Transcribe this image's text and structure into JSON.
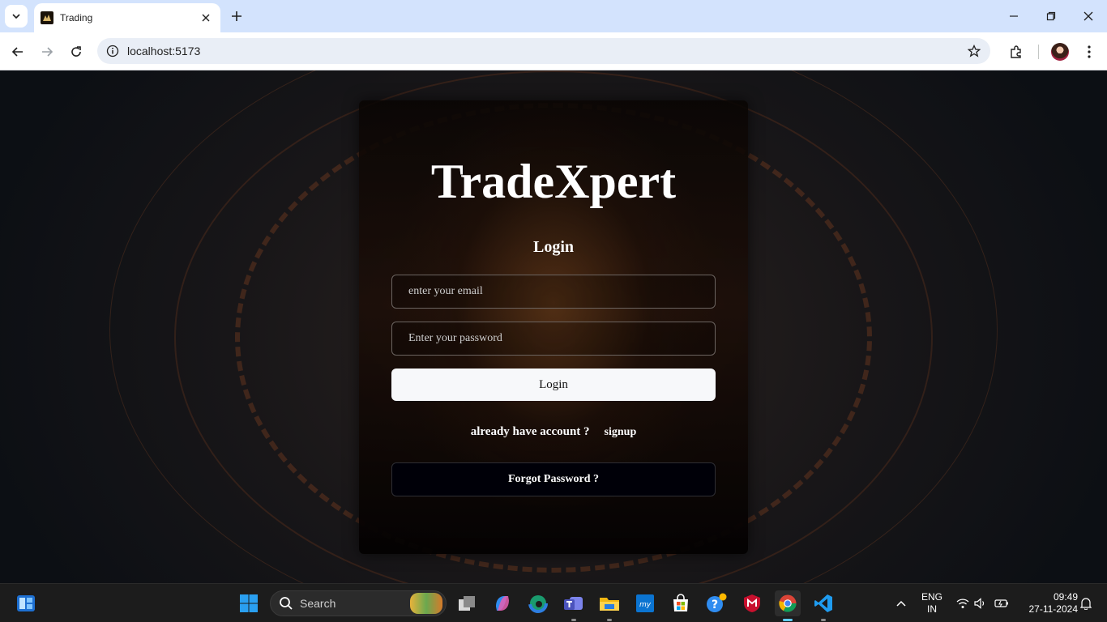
{
  "browser": {
    "tab_title": "Trading",
    "url": "localhost:5173"
  },
  "page": {
    "brand": "TradeXpert",
    "heading": "Login",
    "email_placeholder": "enter your email",
    "password_placeholder": "Enter your password",
    "login_button": "Login",
    "already_text": "already have account ?",
    "signup_link": "signup",
    "forgot_button": "Forgot Password ?"
  },
  "taskbar": {
    "search_label": "Search",
    "language_line1": "ENG",
    "language_line2": "IN",
    "time": "09:49",
    "date": "27-11-2024",
    "apps": [
      "start-icon",
      "search-icon",
      "task-view-icon",
      "copilot-icon",
      "edge-icon",
      "teams-icon",
      "file-explorer-icon",
      "myhp-icon",
      "microsoft-store-icon",
      "help-icon",
      "mcafee-icon",
      "chrome-icon",
      "vscode-icon"
    ]
  },
  "colors": {
    "tabstrip": "#d3e3fd",
    "card_bg": "#140a06",
    "login_button_bg": "#f7f8fa",
    "taskbar_bg": "#1c1c1c",
    "active_indicator": "#60cdff"
  }
}
